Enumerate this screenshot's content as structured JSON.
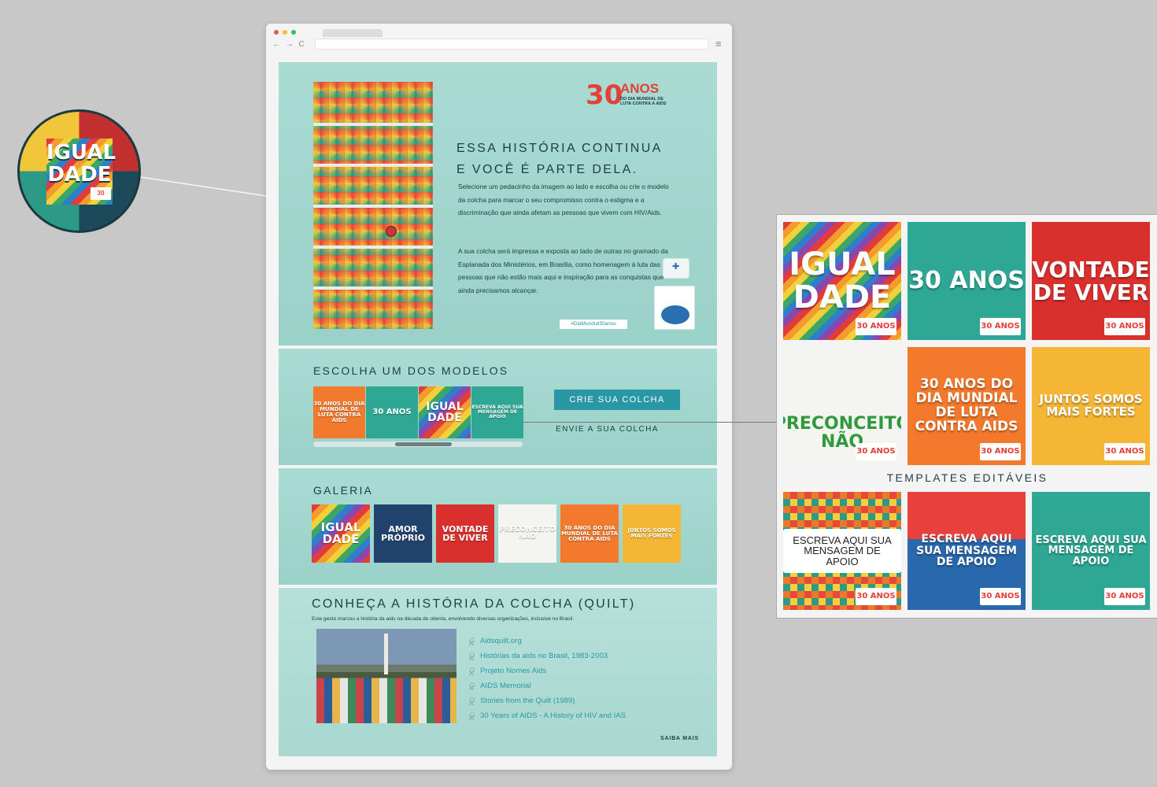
{
  "hero": {
    "logo_number": "30",
    "logo_anos": "ANOS",
    "logo_sub": "DO DIA MUNDIAL DE LUTA CONTRA A AIDS",
    "title_line1": "ESSA HISTÓRIA CONTINUA",
    "title_line2": "E VOCÊ É PARTE DELA.",
    "paragraph1": "Selecione um pedacinho da imagem ao lado e escolha ou crie o modelo da colcha para marcar o seu compromisso contra o estigma e a discriminação que ainda afetam as pessoas que vivem com HIV/Aids.",
    "paragraph2": "A sua colcha será impressa e exposta ao lado de outras no gramado da Esplanada dos Ministérios, em Brasília, como homenagem à luta das pessoas que não estão mais aqui e inspiração para as conquistas que ainda precisamos alcançar.",
    "hashtag": "#DiaMundial30anos"
  },
  "models": {
    "title": "ESCOLHA UM DOS MODELOS",
    "carousel": [
      {
        "text": "30 ANOS DO DIA MUNDIAL DE LUTA CONTRA AIDS",
        "bg": "bg-orange"
      },
      {
        "text": "30 ANOS",
        "bg": "bg-teal"
      },
      {
        "text": "IGUAL DADE",
        "bg": "bg-rainbow"
      },
      {
        "text": "ESCREVA AQUI SUA MENSAGEM DE APOIO",
        "bg": "bg-teal"
      }
    ],
    "create_button": "CRIE SUA COLCHA",
    "send_label": "ENVIE A SUA COLCHA"
  },
  "gallery": {
    "title": "GALERIA",
    "items": [
      {
        "text": "IGUAL DADE",
        "bg": "bg-rainbow"
      },
      {
        "text": "AMOR PRÓPRIO",
        "bg": "bg-navy"
      },
      {
        "text": "VONTADE DE VIVER",
        "bg": "bg-red"
      },
      {
        "text": "PRECONCEITO NÃO",
        "bg": "bg-white"
      },
      {
        "text": "30 ANOS DO DIA MUNDIAL DE LUTA CONTRA AIDS",
        "bg": "bg-orange"
      },
      {
        "text": "JUNTOS SOMOS MAIS FORTES",
        "bg": "bg-yellow"
      }
    ]
  },
  "history": {
    "title": "CONHEÇA A HISTÓRIA DA COLCHA (QUILT)",
    "subtitle": "Este gesto marcou a história da aids na década de oitenta, envolvendo diversas organizações, inclusive no Brasil.",
    "links": [
      "Aidsquilt.org",
      "Histórias da aids no Brasil, 1983-2003",
      "Projeto Nomes Aids",
      "AIDS Memorial",
      "Stories from the Quilt (1989)",
      "30 Years of AIDS - A History of HIV and IAS"
    ],
    "more": "SAIBA MAIS"
  },
  "zoom": {
    "text": "IGUAL DADE",
    "badge": "30"
  },
  "templates": {
    "label": "TEMPLATES EDITÁVEIS",
    "row1": [
      {
        "text": "IGUAL DADE",
        "bg": "bg-rainbow",
        "size": "40px"
      },
      {
        "text": "30 ANOS",
        "bg": "bg-teal",
        "size": "30px"
      },
      {
        "text": "VONTADE DE VIVER",
        "bg": "bg-red",
        "size": "28px"
      }
    ],
    "row2": [
      {
        "text": "PRECONCEITO NÃO",
        "bg": "bg-white",
        "size": "22px"
      },
      {
        "text": "30 ANOS DO DIA MUNDIAL DE LUTA CONTRA AIDS",
        "bg": "bg-orange",
        "size": "17px"
      },
      {
        "text": "JUNTOS SOMOS MAIS FORTES",
        "bg": "bg-yellow",
        "size": "15px"
      }
    ],
    "row3": [
      {
        "text": "ESCREVA AQUI SUA MENSAGEM DE APOIO",
        "bg": "bg-pattern",
        "size": "13px"
      },
      {
        "text": "ESCREVA AQUI SUA MENSAGEM DE APOIO",
        "bg": "bg-blue-red",
        "size": "14px"
      },
      {
        "text": "ESCREVA AQUI SUA MENSAGEM DE APOIO",
        "bg": "bg-teal",
        "size": "13px"
      }
    ],
    "badge": "30 ANOS"
  }
}
